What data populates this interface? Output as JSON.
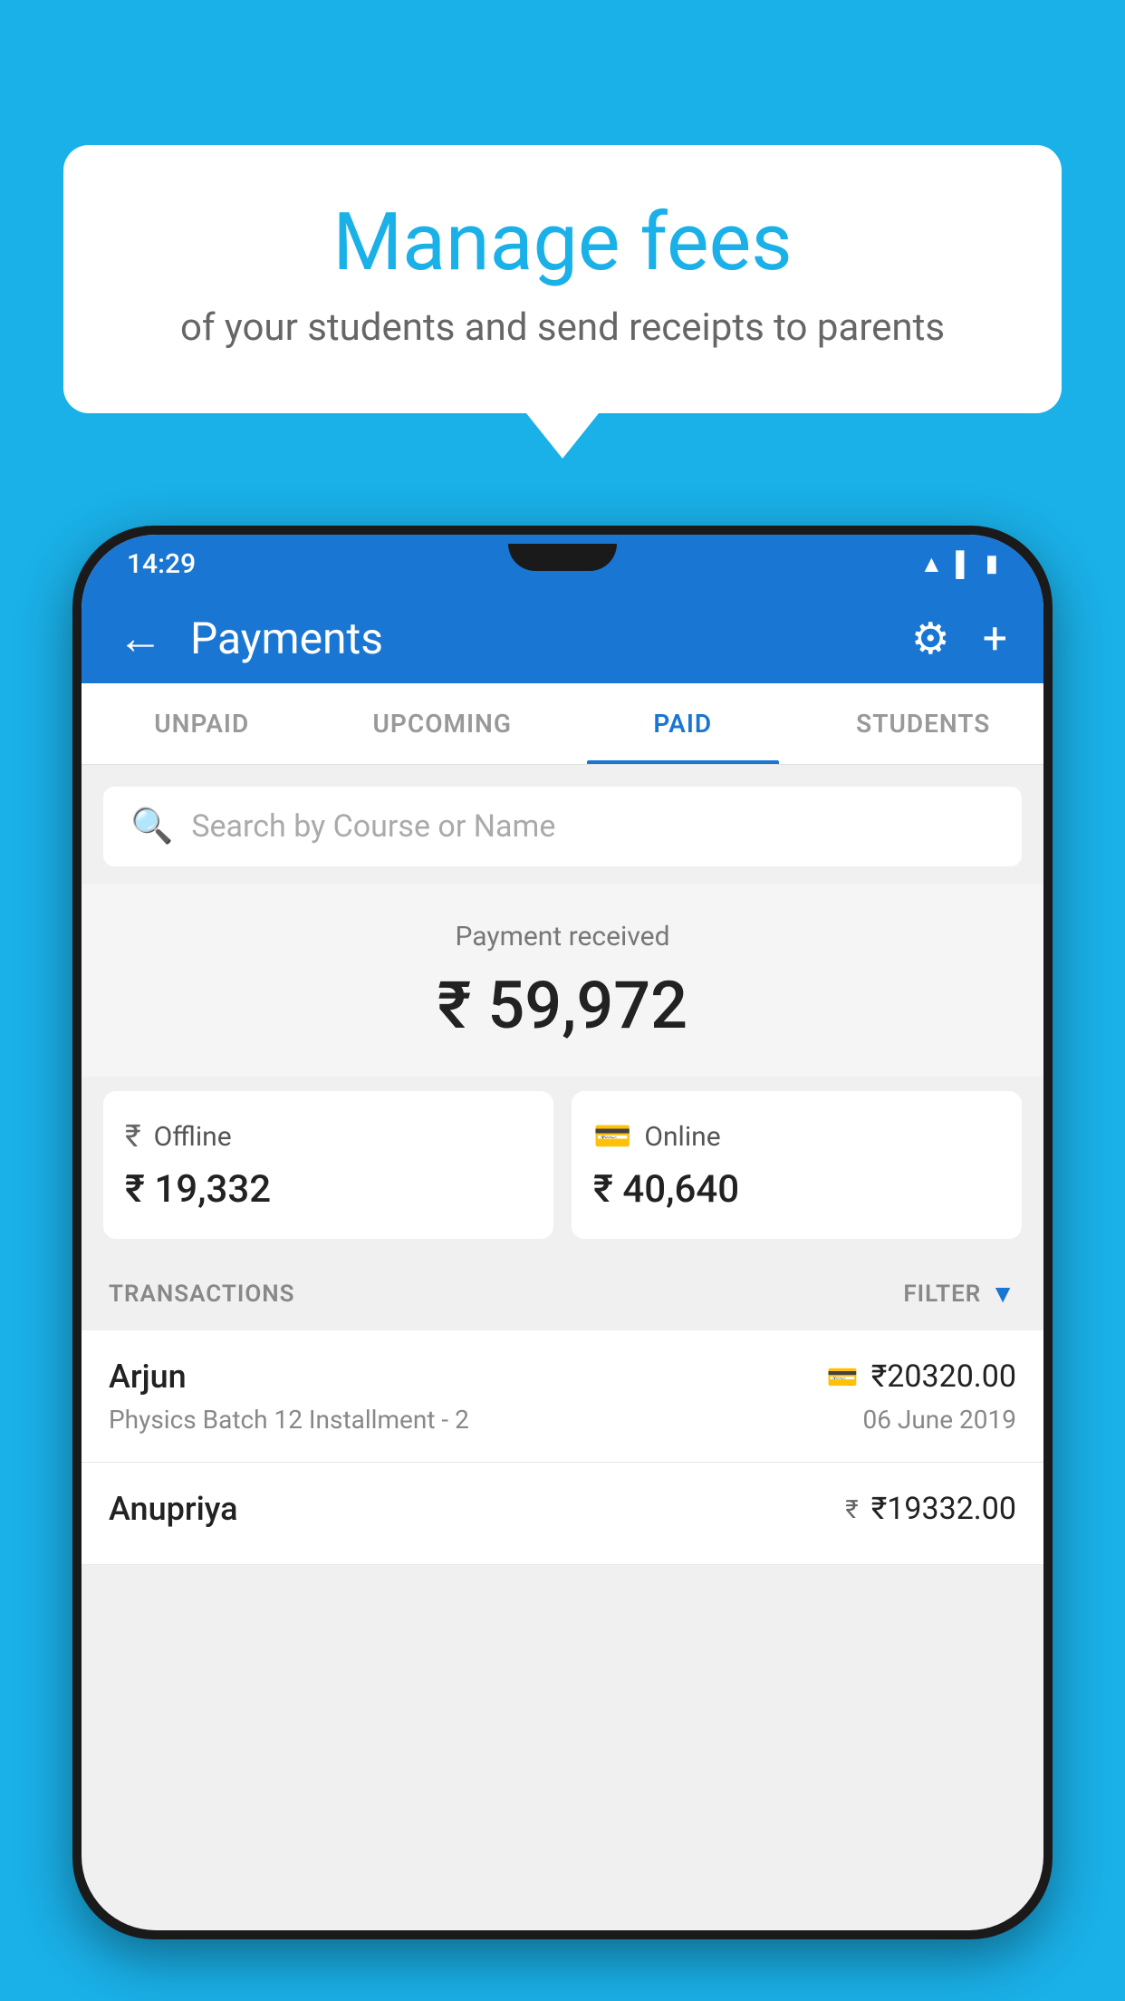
{
  "background": {
    "color": "#1ab0e8"
  },
  "speech_bubble": {
    "title": "Manage fees",
    "subtitle": "of your students and send receipts to parents"
  },
  "phone": {
    "status_bar": {
      "time": "14:29"
    },
    "app_bar": {
      "title": "Payments",
      "back_label": "←",
      "gear_symbol": "⚙",
      "plus_symbol": "+"
    },
    "tabs": [
      {
        "label": "UNPAID",
        "active": false
      },
      {
        "label": "UPCOMING",
        "active": false
      },
      {
        "label": "PAID",
        "active": true
      },
      {
        "label": "STUDENTS",
        "active": false
      }
    ],
    "search": {
      "placeholder": "Search by Course or Name"
    },
    "payment_summary": {
      "label": "Payment received",
      "amount": "₹ 59,972",
      "offline_label": "Offline",
      "offline_amount": "₹ 19,332",
      "online_label": "Online",
      "online_amount": "₹ 40,640"
    },
    "transactions_section": {
      "label": "TRANSACTIONS",
      "filter_label": "FILTER"
    },
    "transactions": [
      {
        "name": "Arjun",
        "course": "Physics Batch 12 Installment - 2",
        "amount": "₹20320.00",
        "date": "06 June 2019",
        "method": "card"
      },
      {
        "name": "Anupriya",
        "course": "",
        "amount": "₹19332.00",
        "date": "",
        "method": "cash"
      }
    ]
  }
}
